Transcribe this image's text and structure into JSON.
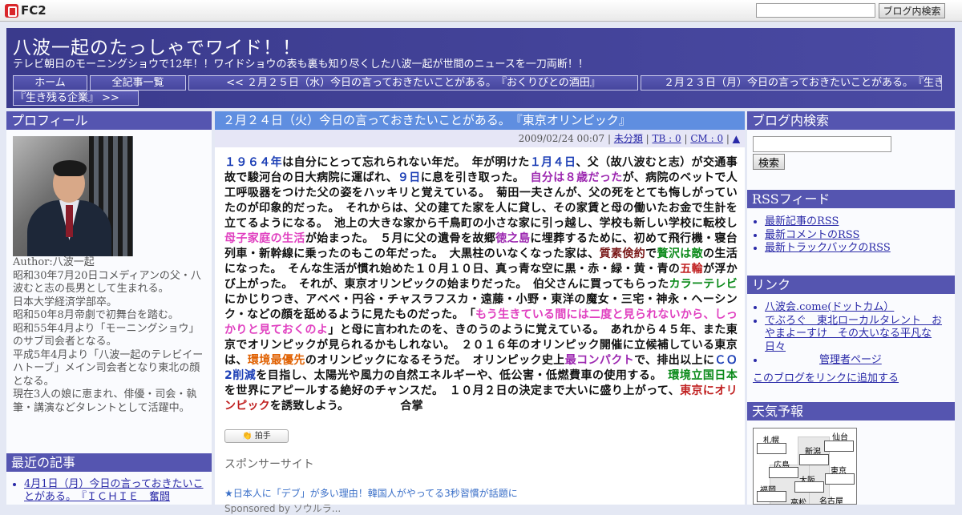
{
  "fc2": {
    "logo_text": "FC2",
    "search_placeholder": "",
    "search_button": "ブログ内検索"
  },
  "header": {
    "title": "八波一起のたっしゃでワイド！！",
    "description": "テレビ朝日のモーニングショウで12年！！ワイドショウの表も裏も知り尽くした八波一起が世間のニュースを一刀両断！！"
  },
  "nav": {
    "home": "ホーム",
    "all": "全記事一覧",
    "prev": "<< ２月２５日（水）今日の言っておきたいことがある。　『おくりびとの酒田』",
    "next": "２月２３日（月）今日の言っておきたいことがある。　『生き残る企業』 >>"
  },
  "profile": {
    "heading": "プロフィール",
    "lines": [
      "Author:八波一起",
      "昭和30年7月20日コメディアンの父・八波むと志の長男として生まれる。",
      "日本大学経済学部卒。",
      "昭和50年8月帝劇で初舞台を踏む。",
      "昭和55年4月より「モーニングショウ」のサブ司会者となる。",
      "平成5年4月より「八波一起のテレビイーハトーブ」メイン司会者となり東北の顔となる。",
      "現在3人の娘に恵まれ、俳優・司会・執筆・講演などタレントとして活躍中。"
    ]
  },
  "recent": {
    "heading": "最近の記事",
    "items": [
      "4月1日（月）今日の言っておきたいことがある。　『ＩＣＨＩＥ　奮闘"
    ]
  },
  "entry": {
    "title": "２月２４日（火）今日の言っておきたいことがある。　『東京オリンピック』",
    "date": "2009/02/24 00:07",
    "category": "未分類",
    "tb": "TB : 0",
    "cm": "CM : 0",
    "up": "▲",
    "segments": [
      {
        "t": "１９６４年",
        "c": "b"
      },
      {
        "t": "は自分にとって忘れられない年だ。　年が明けた"
      },
      {
        "t": "１月４日",
        "c": "b"
      },
      {
        "t": "、父（故八波むと志）が交通事故で駿河台の日大病院に運ばれ、"
      },
      {
        "t": "９日",
        "c": "b"
      },
      {
        "t": "に息を引き取った。　"
      },
      {
        "t": "自分は８歳だった",
        "c": "p"
      },
      {
        "t": "が、病院のベットで人工呼吸器をつけた父の姿をハッキリと覚えている。　菊田一夫さんが、父の死をとても悔しがっていたのが印象的だった。　それからは、父の建てた家を人に貸し、その家賃と母の働いたお金で生計を立てるようになる。　池上の大きな家から千鳥町の小さな家に引っ越し、学校も新しい学校に転校し"
      },
      {
        "t": "母子家庭の生活",
        "c": "m"
      },
      {
        "t": "が始まった。　５月に父の遺骨を故郷"
      },
      {
        "t": "徳之島",
        "c": "p"
      },
      {
        "t": "に埋葬するために、初めて飛行機・寝台列車・新幹線に乗ったのもこの年だった。　大黒柱のいなくなった家は、"
      },
      {
        "t": "質素倹約",
        "c": "d"
      },
      {
        "t": "で"
      },
      {
        "t": "贅沢は敵",
        "c": "g"
      },
      {
        "t": "の生活になった。　そんな生活が慣れ始めた１０月１０日、真っ青な空に黒・赤・緑・黄・青の"
      },
      {
        "t": "五輪",
        "c": "r"
      },
      {
        "t": "が浮かび上がった。　それが、東京オリンピックの始まりだった。　伯父さんに買ってもらった"
      },
      {
        "t": "カラーテレビ",
        "c": "g"
      },
      {
        "t": "にかじりつき、アベベ・円谷・チャスラフスカ・遠藤・小野・東洋の魔女・三宅・神永・ヘーシンク・などの顔を舐めるように見たものだった。　「"
      },
      {
        "t": "もう生きている間には二度と見られないから、しっかりと見ておくのよ",
        "c": "m"
      },
      {
        "t": "」と母に言われたのを、きのうのように覚えている。　あれから４５年、また東京でオリンピックが見られるかもしれない。　２０１６年のオリンピック開催に立候補している東京は、"
      },
      {
        "t": "環境最優先",
        "c": "o"
      },
      {
        "t": "のオリンピックになるそうだ。　オリンピック史上"
      },
      {
        "t": "最コンパクト",
        "c": "p"
      },
      {
        "t": "で、排出以上に"
      },
      {
        "t": "ＣＯ2削減",
        "c": "b"
      },
      {
        "t": "を目指し、太陽光や風力の自然エネルギーや、低公害・低燃費車の使用する。　"
      },
      {
        "t": "環境立国日本",
        "c": "g"
      },
      {
        "t": "を世界にアピールする絶好のチャンスだ。　１０月２日の決定まで大いに盛り上がって、"
      },
      {
        "t": "東京にオリンピック",
        "c": "r"
      },
      {
        "t": "を誘致しよう。　　　　　合掌"
      }
    ],
    "clap_label": "拍手",
    "sponsor_label": "スポンサーサイト",
    "sponsor_link": "★日本人に「デブ」が多い理由！韓国人がやってる3秒習慣が話題に",
    "sponsor_sub": "Sponsored by ソウルラ..."
  },
  "right": {
    "search_heading": "ブログ内検索",
    "search_button": "検索",
    "rss_heading": "RSSフィード",
    "rss_items": [
      "最新記事のRSS",
      "最新コメントのRSS",
      "最新トラックバックのRSS"
    ],
    "links_heading": "リンク",
    "links_items": [
      "八波会.come(ドットカム）",
      "でぶろぐ　東北ローカルタレント　おやまよーすけ　その大いなる平凡な日々",
      "管理者ページ"
    ],
    "links_add": "このブログをリンクに追加する",
    "weather_heading": "天気予報",
    "weather_cities": [
      "札幌",
      "仙台",
      "新潟",
      "広島",
      "東京",
      "大阪",
      "福岡",
      "高松",
      "名古屋"
    ]
  },
  "colors": {
    "header_bg": "#3a3a8c",
    "sidehead_bg": "#5555b0",
    "entry_title_bg": "#5f8ee0",
    "link": "#2a2aa8"
  }
}
